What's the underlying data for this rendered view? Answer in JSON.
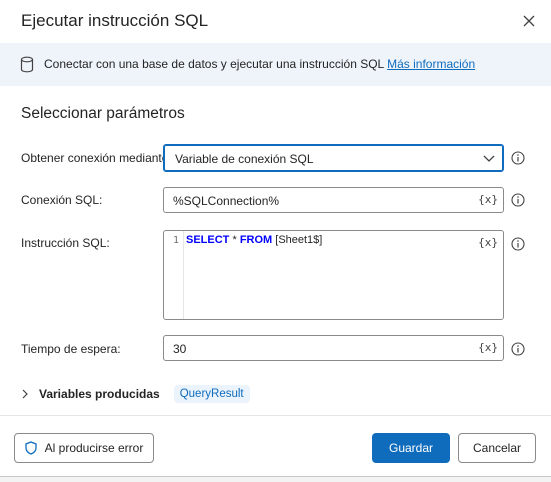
{
  "dialog": {
    "title": "Ejecutar instrucción SQL",
    "close_label": "✕"
  },
  "info": {
    "text": "Conectar con una base de datos y ejecutar una instrucción SQL ",
    "link": "Más información"
  },
  "section": {
    "title": "Seleccionar parámetros"
  },
  "fields": {
    "connection_mode": {
      "label": "Obtener conexión mediante:",
      "value": "Variable de conexión SQL"
    },
    "sql_connection": {
      "label": "Conexión SQL:",
      "value": "%SQLConnection%"
    },
    "sql_statement": {
      "label": "Instrucción SQL:",
      "line_number": "1",
      "kw_select": "SELECT",
      "star": " * ",
      "kw_from": "FROM",
      "rest": " [Sheet1$]"
    },
    "timeout": {
      "label": "Tiempo de espera:",
      "value": "30"
    },
    "var_button": "{x}"
  },
  "produced": {
    "label": "Variables producidas",
    "variable": "QueryResult"
  },
  "footer": {
    "error_button": "Al producirse error",
    "save_button": "Guardar",
    "cancel_button": "Cancelar"
  },
  "colors": {
    "accent": "#0f6cbd",
    "info_bar": "#eff4fb",
    "keyword": "#0000ff"
  }
}
